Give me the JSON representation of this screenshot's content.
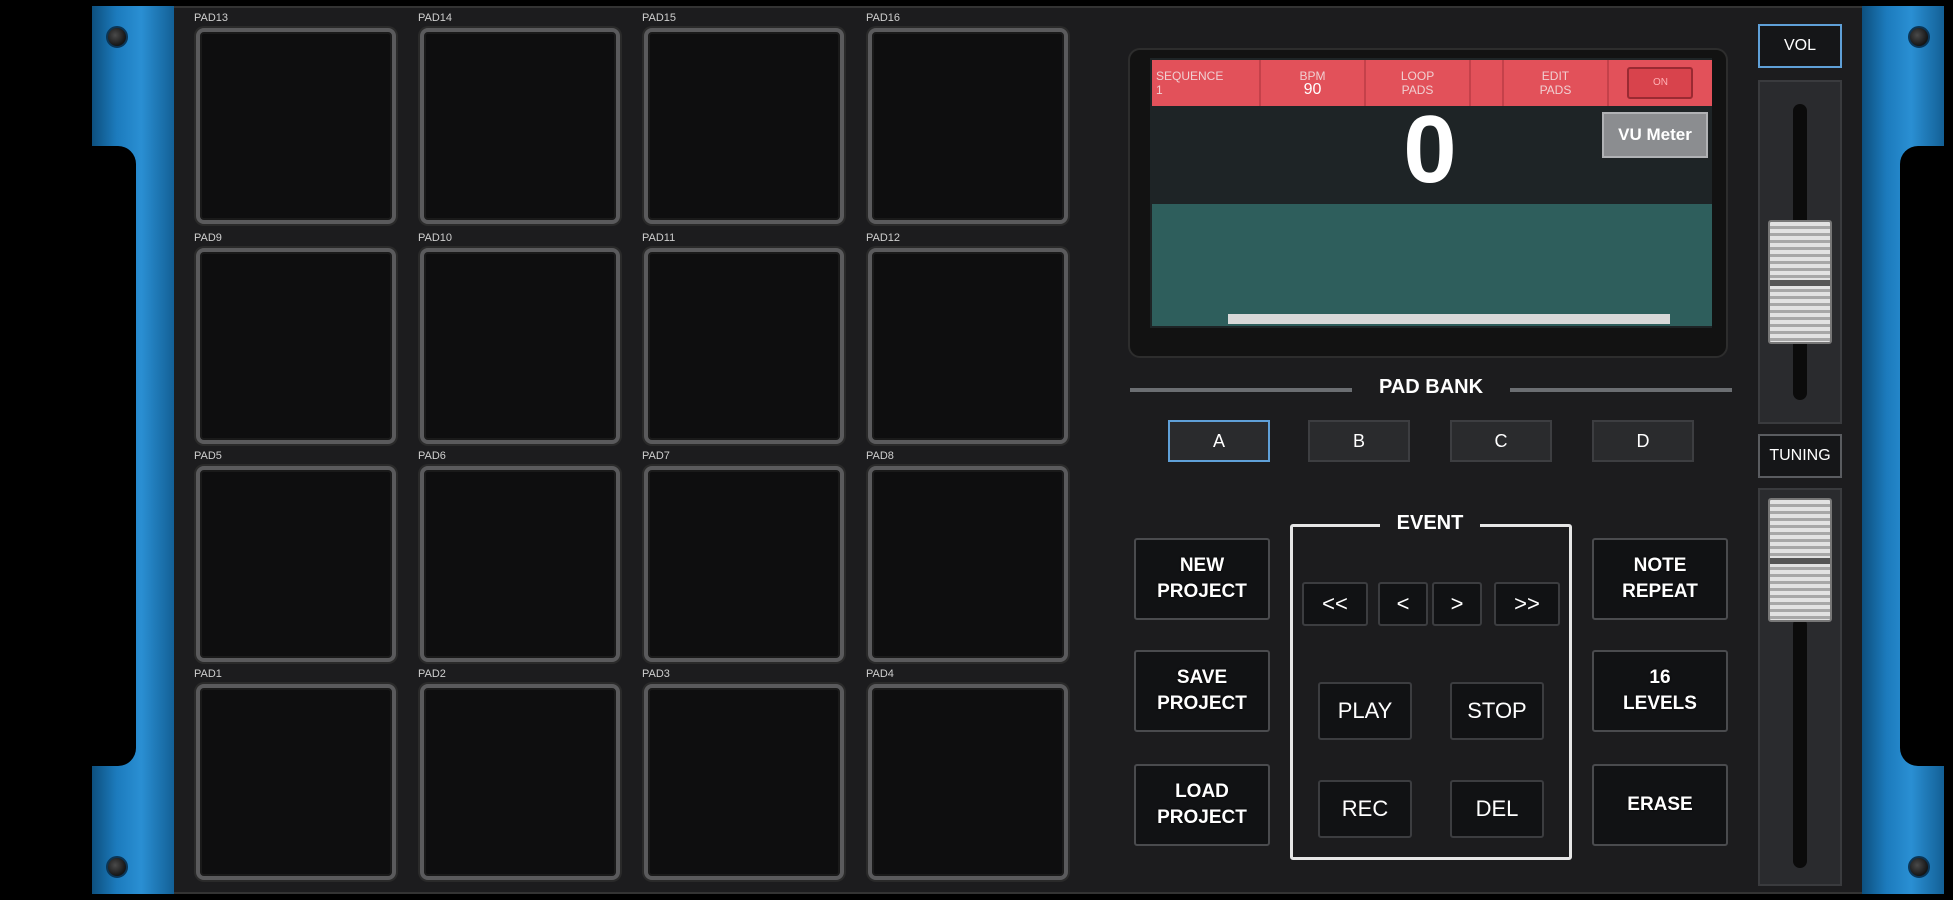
{
  "pads": [
    {
      "label": "PAD13"
    },
    {
      "label": "PAD14"
    },
    {
      "label": "PAD15"
    },
    {
      "label": "PAD16"
    },
    {
      "label": "PAD9"
    },
    {
      "label": "PAD10"
    },
    {
      "label": "PAD11"
    },
    {
      "label": "PAD12"
    },
    {
      "label": "PAD5"
    },
    {
      "label": "PAD6"
    },
    {
      "label": "PAD7"
    },
    {
      "label": "PAD8"
    },
    {
      "label": "PAD1"
    },
    {
      "label": "PAD2"
    },
    {
      "label": "PAD3"
    },
    {
      "label": "PAD4"
    }
  ],
  "display": {
    "sequence_label": "SEQUENCE",
    "sequence_value": "1",
    "bpm_label": "BPM",
    "bpm_value": "90",
    "loop_label": "LOOP\nPADS",
    "edit_label": "EDIT\nPADS",
    "toggle_label": "ON",
    "counter": "0",
    "vu_meter": "VU Meter"
  },
  "pad_bank": {
    "title": "PAD BANK",
    "banks": [
      "A",
      "B",
      "C",
      "D"
    ],
    "active": "A"
  },
  "left_buttons": {
    "new_project": "NEW\nPROJECT",
    "save_project": "SAVE\nPROJECT",
    "load_project": "LOAD\nPROJECT"
  },
  "event": {
    "title": "EVENT",
    "rewind": "<<",
    "prev": "<",
    "next": ">",
    "forward": ">>",
    "play": "PLAY",
    "stop": "STOP",
    "rec": "REC",
    "del": "DEL"
  },
  "right_buttons": {
    "note_repeat": "NOTE\nREPEAT",
    "levels": "16\nLEVELS",
    "erase": "ERASE"
  },
  "strip": {
    "vol": "VOL",
    "tuning": "TUNING"
  },
  "colors": {
    "rack_blue": "#1c7bbd",
    "lcd_header": "#e2515a",
    "lcd_wave": "#2e5e5c",
    "active_outline": "#5fa0d8"
  }
}
